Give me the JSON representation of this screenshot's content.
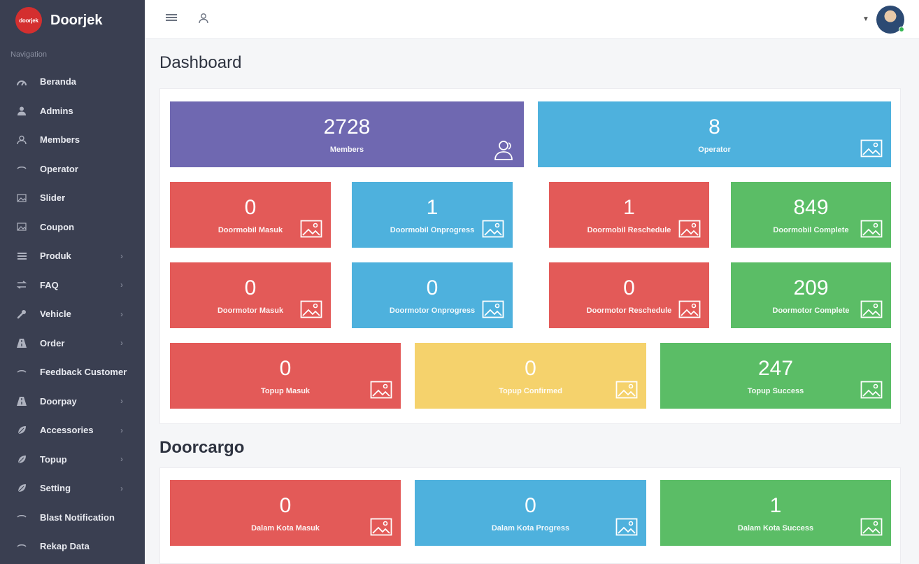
{
  "brand": {
    "name": "Doorjek",
    "logo_text": "doorjek"
  },
  "sidebar": {
    "header": "Navigation",
    "items": [
      {
        "label": "Beranda",
        "icon": "dashboard-icon",
        "arrow": false
      },
      {
        "label": "Admins",
        "icon": "user-icon",
        "arrow": false
      },
      {
        "label": "Members",
        "icon": "users-icon",
        "arrow": false
      },
      {
        "label": "Operator",
        "icon": "eye-icon",
        "arrow": false
      },
      {
        "label": "Slider",
        "icon": "image-icon",
        "arrow": false
      },
      {
        "label": "Coupon",
        "icon": "image-icon",
        "arrow": false
      },
      {
        "label": "Produk",
        "icon": "list-icon",
        "arrow": true
      },
      {
        "label": "FAQ",
        "icon": "exchange-icon",
        "arrow": true
      },
      {
        "label": "Vehicle",
        "icon": "wrench-icon",
        "arrow": true
      },
      {
        "label": "Order",
        "icon": "road-icon",
        "arrow": true
      },
      {
        "label": "Feedback Customer",
        "icon": "eye-icon",
        "arrow": false
      },
      {
        "label": "Doorpay",
        "icon": "road-icon",
        "arrow": true
      },
      {
        "label": "Accessories",
        "icon": "leaf-icon",
        "arrow": true
      },
      {
        "label": "Topup",
        "icon": "leaf-icon",
        "arrow": true
      },
      {
        "label": "Setting",
        "icon": "leaf-icon",
        "arrow": true
      },
      {
        "label": "Blast Notification",
        "icon": "eye-icon",
        "arrow": false
      },
      {
        "label": "Rekap Data",
        "icon": "eye-icon",
        "arrow": false
      }
    ]
  },
  "page": {
    "title": "Dashboard"
  },
  "dashboard_tiles": [
    {
      "value": "2728",
      "label": "Members",
      "color": "#6f68b1",
      "icon": "users-icon"
    },
    {
      "value": "8",
      "label": "Operator",
      "color": "#4eb1dd",
      "icon": "image-icon"
    },
    {
      "value": "0",
      "label": "Doormobil Masuk",
      "color": "#e35a58",
      "icon": "image-icon"
    },
    {
      "value": "1",
      "label": "Doormobil Onprogress",
      "color": "#4eb1dd",
      "icon": "image-icon"
    },
    {
      "value": "1",
      "label": "Doormobil Reschedule",
      "color": "#e35a58",
      "icon": "image-icon"
    },
    {
      "value": "849",
      "label": "Doormobil Complete",
      "color": "#5bbd66",
      "icon": "image-icon"
    },
    {
      "value": "0",
      "label": "Doormotor Masuk",
      "color": "#e35a58",
      "icon": "image-icon"
    },
    {
      "value": "0",
      "label": "Doormotor Onprogress",
      "color": "#4eb1dd",
      "icon": "image-icon"
    },
    {
      "value": "0",
      "label": "Doormotor Reschedule",
      "color": "#e35a58",
      "icon": "image-icon"
    },
    {
      "value": "209",
      "label": "Doormotor Complete",
      "color": "#5bbd66",
      "icon": "image-icon"
    },
    {
      "value": "0",
      "label": "Topup Masuk",
      "color": "#e35a58",
      "icon": "image-icon"
    },
    {
      "value": "0",
      "label": "Topup Confirmed",
      "color": "#f5d26c",
      "icon": "image-icon"
    },
    {
      "value": "247",
      "label": "Topup Success",
      "color": "#5bbd66",
      "icon": "image-icon"
    }
  ],
  "doorcargo": {
    "title": "Doorcargo",
    "tiles": [
      {
        "value": "0",
        "label": "Dalam Kota Masuk",
        "color": "#e35a58",
        "icon": "image-icon"
      },
      {
        "value": "0",
        "label": "Dalam Kota Progress",
        "color": "#4eb1dd",
        "icon": "image-icon"
      },
      {
        "value": "1",
        "label": "Dalam Kota Success",
        "color": "#5bbd66",
        "icon": "image-icon"
      }
    ]
  },
  "topbar": {
    "menu_icon": "menu-icon",
    "user_icon": "user-icon",
    "dropdown_icon": "caret-down-icon"
  }
}
